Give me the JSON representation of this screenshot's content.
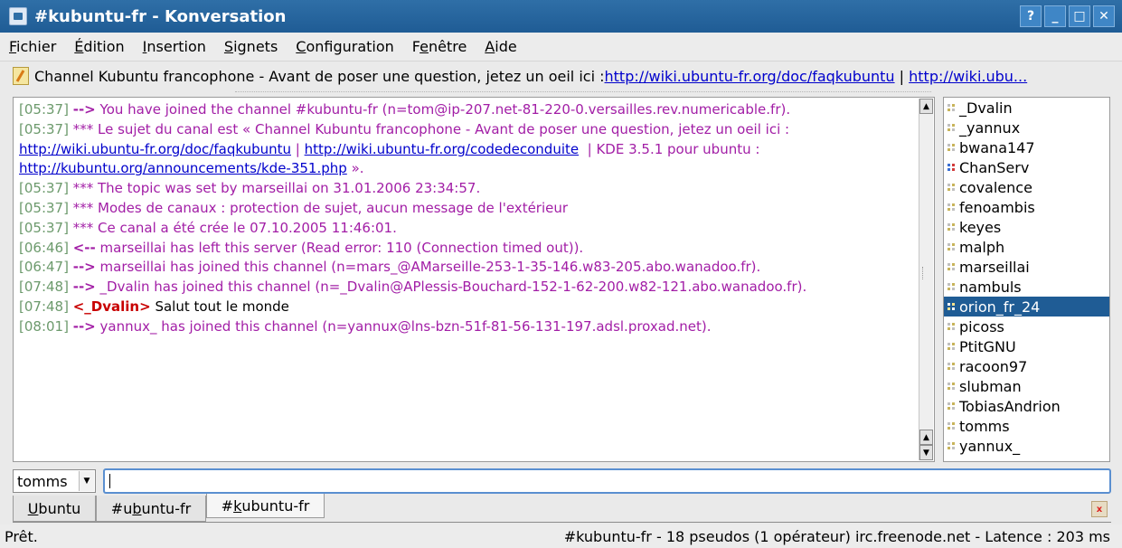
{
  "window": {
    "title": "#kubuntu-fr - Konversation",
    "buttons": [
      "?",
      "_",
      "□",
      "✕"
    ]
  },
  "menu": [
    {
      "pre": "",
      "key": "F",
      "post": "ichier"
    },
    {
      "pre": "",
      "key": "É",
      "post": "dition"
    },
    {
      "pre": "",
      "key": "I",
      "post": "nsertion"
    },
    {
      "pre": "",
      "key": "S",
      "post": "ignets"
    },
    {
      "pre": "",
      "key": "C",
      "post": "onfiguration"
    },
    {
      "pre": "F",
      "key": "e",
      "post": "nêtre"
    },
    {
      "pre": "",
      "key": "A",
      "post": "ide"
    }
  ],
  "topic": {
    "text": "Channel Kubuntu francophone - Avant de poser une question, jetez un oeil ici : ",
    "link1": "http://wiki.ubuntu-fr.org/doc/faqkubuntu",
    "sep": " | ",
    "link2": "http://wiki.ubu..."
  },
  "chat": {
    "lines": [
      {
        "ts": "[05:37]",
        "arrow": "-->",
        "msg": "You have joined the channel #kubuntu-fr (n=tom@ip-207.net-81-220-0.versailles.rev.numericable.fr)."
      },
      {
        "ts": "[05:37]",
        "arrow": "***",
        "msg": "Le sujet du canal est « Channel Kubuntu francophone - Avant de poser une question, jetez un oeil ici :"
      },
      {
        "ts": "[05:37]",
        "arrow": "***",
        "msg": "The topic was set by marseillai on 31.01.2006 23:34:57."
      },
      {
        "ts": "[05:37]",
        "arrow": "***",
        "msg": "Modes de canaux : protection de sujet, aucun message de l'extérieur"
      },
      {
        "ts": "[05:37]",
        "arrow": "***",
        "msg": "Ce canal a été crée le 07.10.2005 11:46:01."
      },
      {
        "ts": "[06:46]",
        "arrow": "<--",
        "msg": "marseillai has left this server (Read error: 110 (Connection timed out))."
      },
      {
        "ts": "[06:47]",
        "arrow": "-->",
        "msg": "marseillai has joined this channel (n=mars_@AMarseille-253-1-35-146.w83-205.abo.wanadoo.fr)."
      },
      {
        "ts": "[07:48]",
        "arrow": "-->",
        "msg": "_Dvalin has joined this channel (n=_Dvalin@APlessis-Bouchard-152-1-62-200.w82-121.abo.wanadoo.fr)."
      },
      {
        "ts": "[07:48]",
        "nick": "<_Dvalin>",
        "msg": "Salut tout le monde"
      },
      {
        "ts": "[08:01]",
        "arrow": "-->",
        "msg": "yannux_ has joined this channel (n=yannux@lns-bzn-51f-81-56-131-197.adsl.proxad.net)."
      }
    ],
    "topic_cont": {
      "link1": "http://wiki.ubuntu-fr.org/doc/faqkubuntu",
      "sep1": " | ",
      "link2": "http://wiki.ubuntu-fr.org/codedeconduite",
      "text": "  | KDE 3.5.1 pour ubuntu :",
      "link3": "http://kubuntu.org/announcements/kde-351.php",
      "end": " »."
    }
  },
  "nicks": [
    {
      "name": "_Dvalin"
    },
    {
      "name": "_yannux"
    },
    {
      "name": "bwana147"
    },
    {
      "name": "ChanServ",
      "op": true
    },
    {
      "name": "covalence"
    },
    {
      "name": "fenoambis"
    },
    {
      "name": "keyes"
    },
    {
      "name": "malph"
    },
    {
      "name": "marseillai"
    },
    {
      "name": "nambuls"
    },
    {
      "name": "orion_fr_24",
      "selected": true
    },
    {
      "name": "picoss"
    },
    {
      "name": "PtitGNU"
    },
    {
      "name": "racoon97"
    },
    {
      "name": "slubman"
    },
    {
      "name": "TobiasAndrion"
    },
    {
      "name": "tomms"
    },
    {
      "name": "yannux_"
    }
  ],
  "input": {
    "nick": "tomms",
    "value": ""
  },
  "tabs": [
    {
      "pre": "",
      "key": "U",
      "post": "buntu"
    },
    {
      "pre": "#u",
      "key": "b",
      "post": "untu-fr"
    },
    {
      "pre": "#",
      "key": "k",
      "post": "ubuntu-fr",
      "active": true
    }
  ],
  "status": {
    "left": "Prêt.",
    "right": "#kubuntu-fr - 18 pseudos (1 opérateur) irc.freenode.net - Latence : 203 ms"
  }
}
